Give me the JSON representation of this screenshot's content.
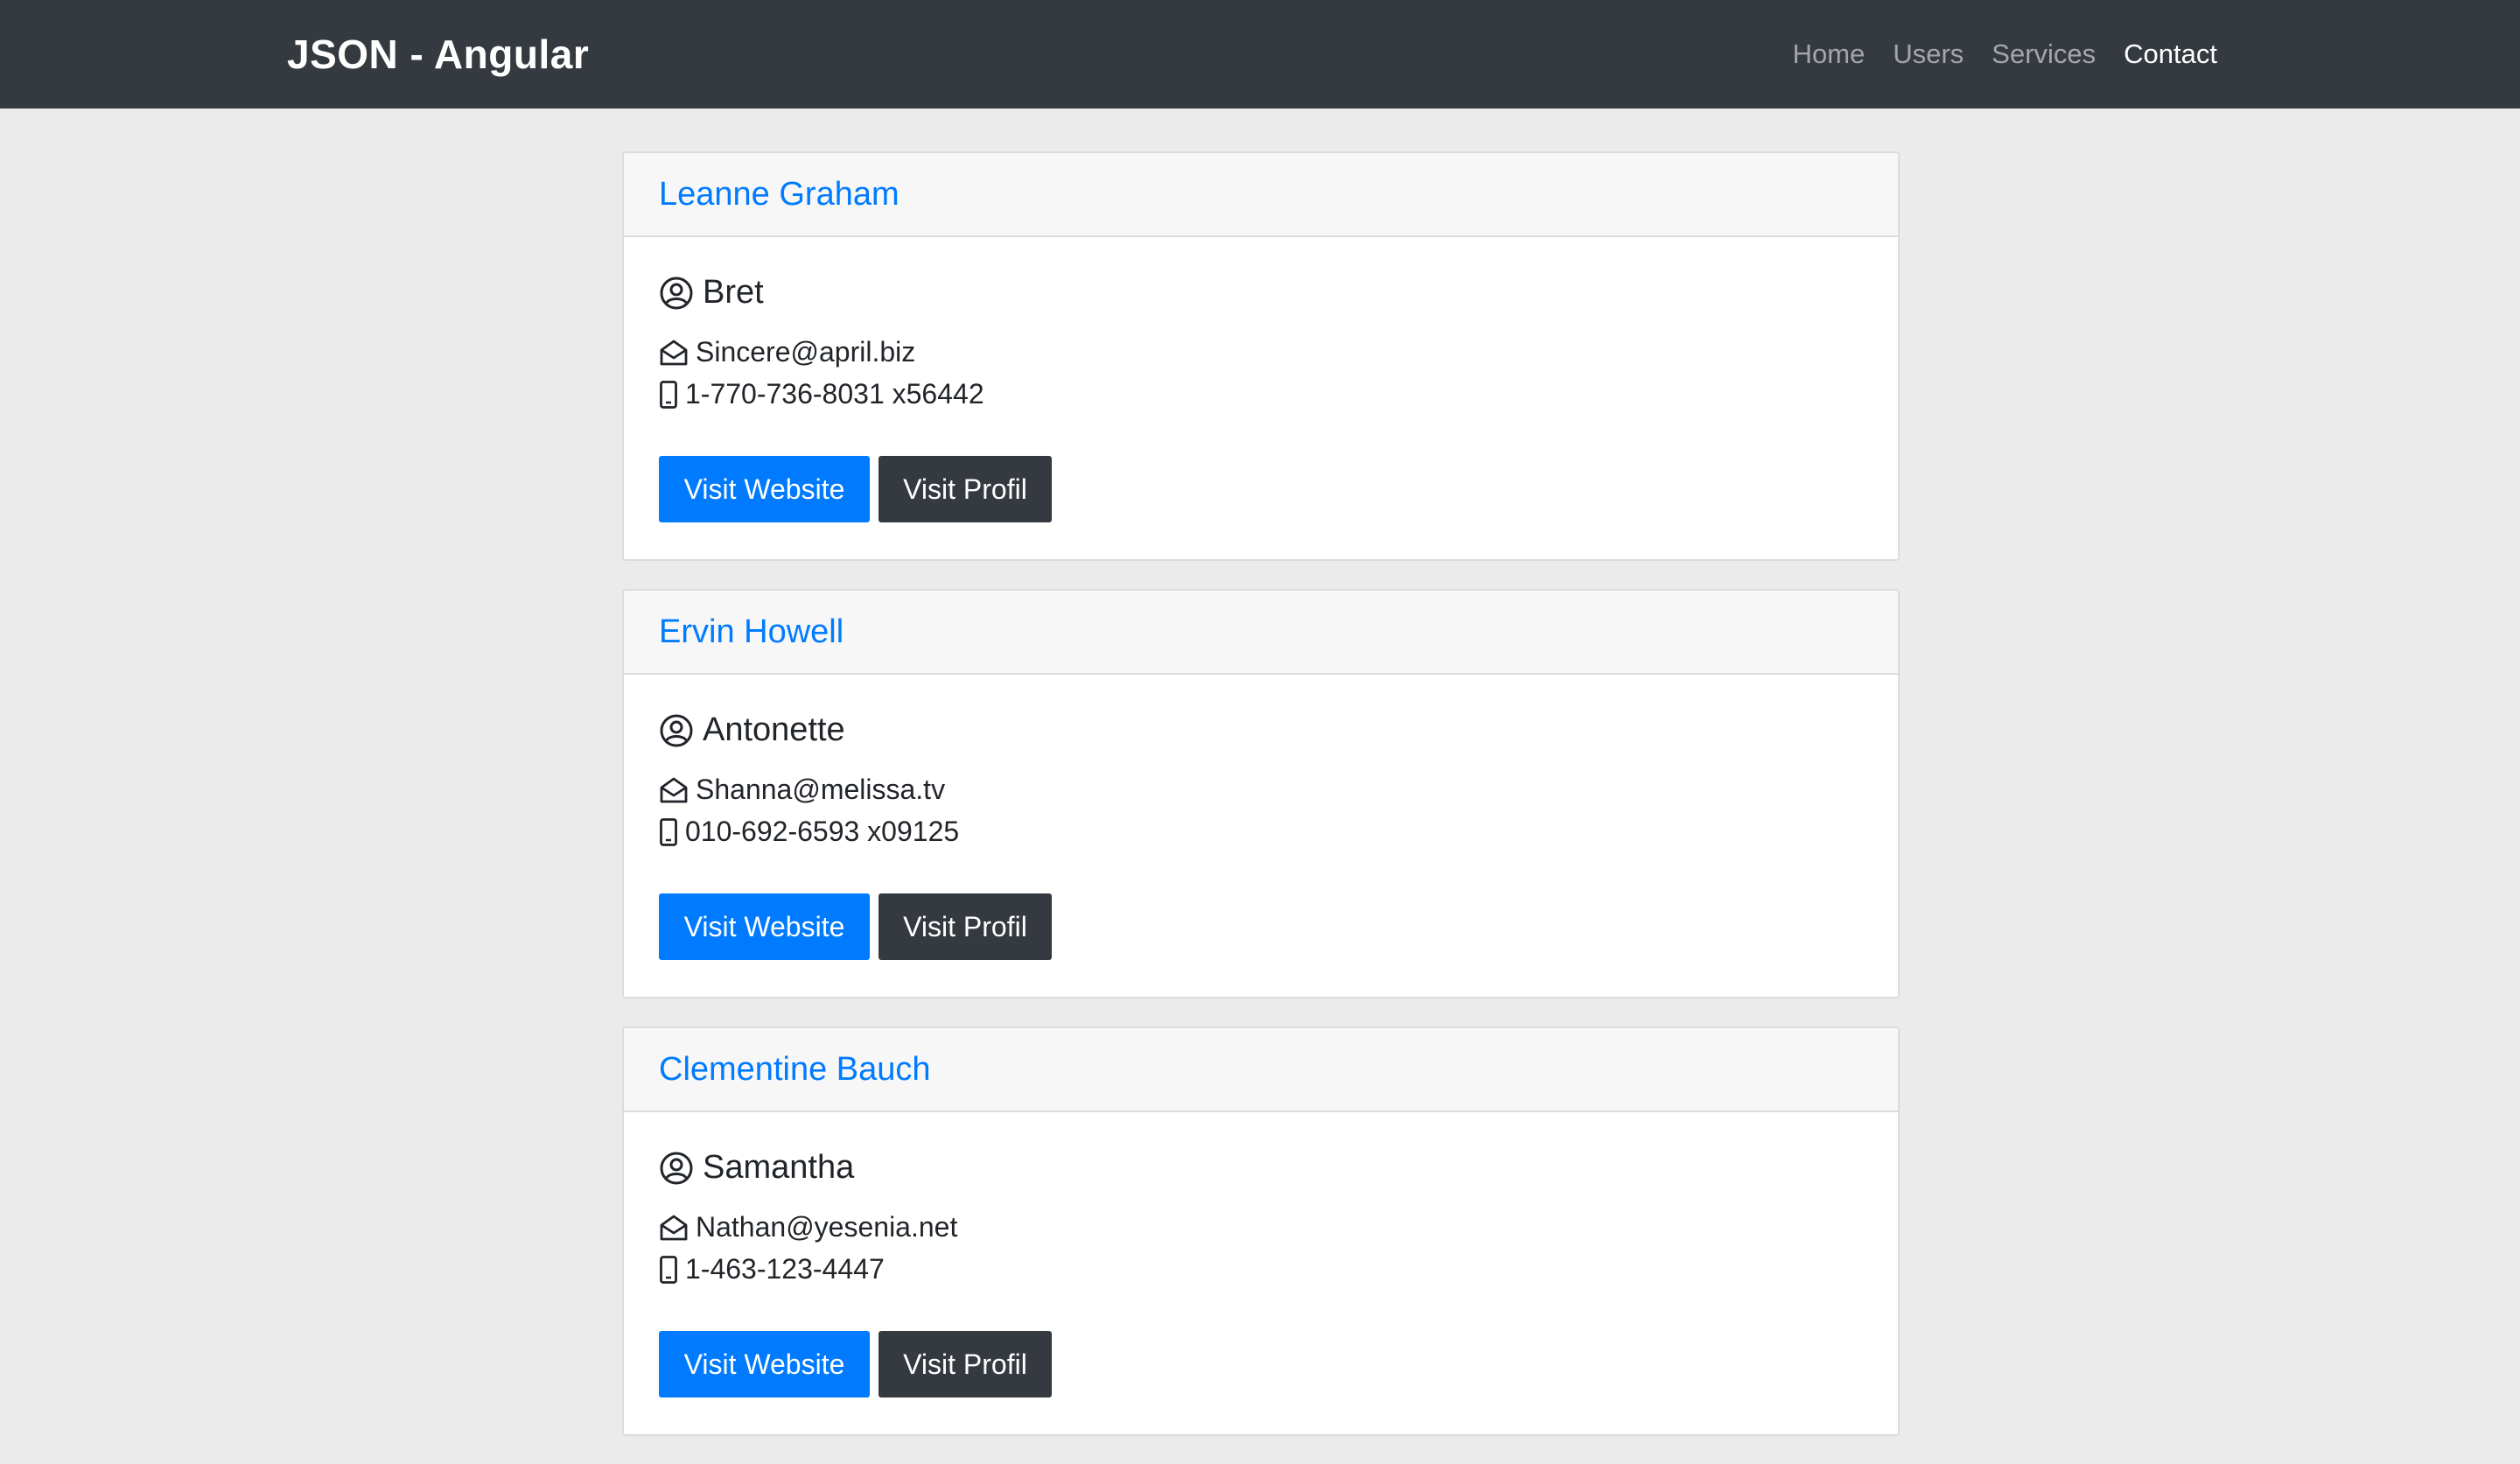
{
  "navbar": {
    "brand": "JSON - Angular",
    "links": [
      {
        "label": "Home"
      },
      {
        "label": "Users"
      },
      {
        "label": "Services"
      },
      {
        "label": "Contact"
      }
    ]
  },
  "users": [
    {
      "name": "Leanne Graham",
      "username": "Bret",
      "email": "Sincere@april.biz",
      "phone": "1-770-736-8031 x56442",
      "website_label": "Visit Website",
      "profile_label": "Visit Profil"
    },
    {
      "name": "Ervin Howell",
      "username": "Antonette",
      "email": "Shanna@melissa.tv",
      "phone": "010-692-6593 x09125",
      "website_label": "Visit Website",
      "profile_label": "Visit Profil"
    },
    {
      "name": "Clementine Bauch",
      "username": "Samantha",
      "email": "Nathan@yesenia.net",
      "phone": "1-463-123-4447",
      "website_label": "Visit Website",
      "profile_label": "Visit Profil"
    }
  ],
  "icons": {
    "user": "user-circle-icon",
    "email": "envelope-open-icon",
    "phone": "mobile-phone-icon"
  },
  "colors": {
    "navbar": "#343a40",
    "link": "#007bff",
    "primary_button": "#007bff",
    "dark_button": "#343a40",
    "page_background": "#ebebeb"
  }
}
